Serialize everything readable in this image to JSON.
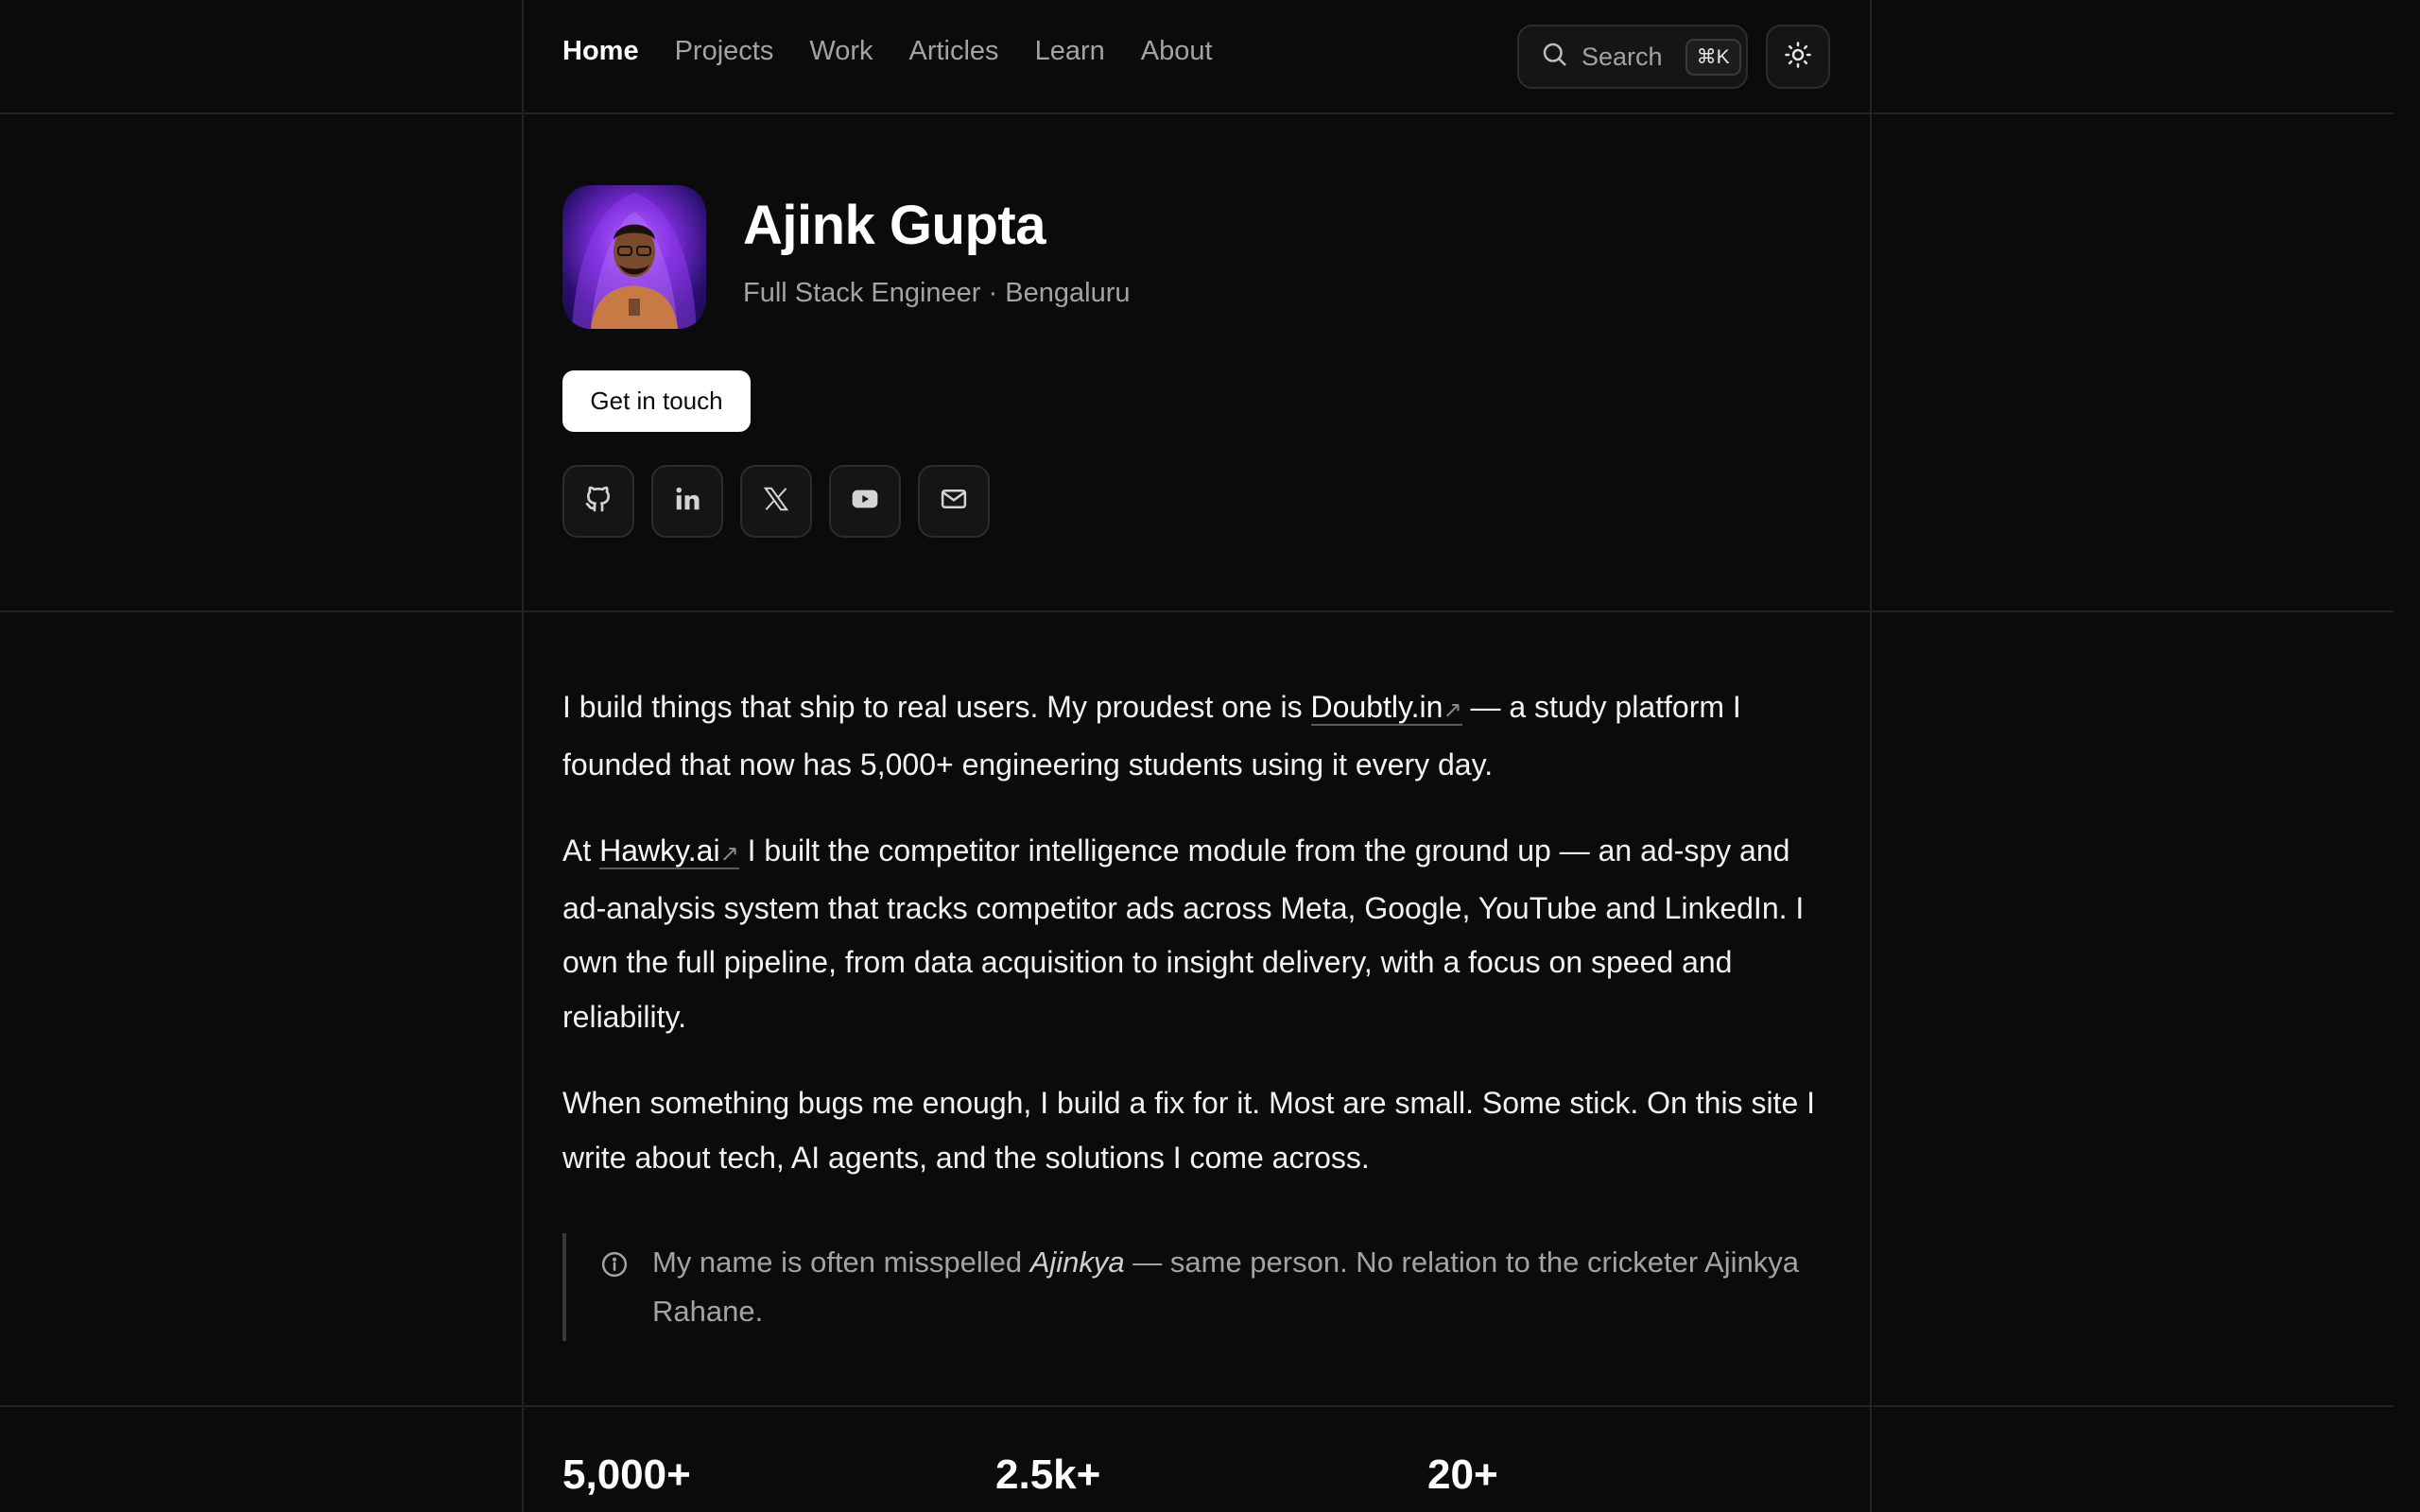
{
  "nav": {
    "items": [
      {
        "label": "Home",
        "active": true
      },
      {
        "label": "Projects"
      },
      {
        "label": "Work"
      },
      {
        "label": "Articles"
      },
      {
        "label": "Learn"
      },
      {
        "label": "About"
      }
    ],
    "search": {
      "label": "Search",
      "shortcut": "⌘K",
      "icon": "search-icon"
    },
    "theme_toggle_icon": "sun-icon"
  },
  "profile": {
    "name": "Ajink Gupta",
    "role": "Full Stack Engineer",
    "separator": "·",
    "location": "Bengaluru",
    "cta_label": "Get in touch",
    "socials": [
      "github-icon",
      "linkedin-icon",
      "x-icon",
      "youtube-icon",
      "mail-icon"
    ]
  },
  "bio": {
    "p1": {
      "before": "I build things that ship to real users. My proudest one is ",
      "link": "Doubtly.in",
      "after": " — a study platform I founded that now has 5,000+ engineering students using it every day."
    },
    "p2": {
      "before": "At ",
      "link": "Hawky.ai",
      "after": " I built the competitor intelligence module from the ground up — an ad-spy and ad-analysis system that tracks competitor ads across Meta, Google, YouTube and LinkedIn. I own the full pipeline, from data acquisition to insight delivery, with a focus on speed and reliability."
    },
    "p3": "When something bugs me enough, I build a fix for it. Most are small. Some stick. On this site I write about tech, AI agents, and the solutions I come across.",
    "ext_arrow": "↗"
  },
  "note": {
    "before": "My name is often misspelled ",
    "emphasis": "Ajinkya",
    "after": " — same person. No relation to the cricketer Ajinkya Rahane."
  },
  "stats": [
    {
      "value": "5,000+"
    },
    {
      "value": "2.5k+"
    },
    {
      "value": "20+"
    }
  ],
  "colors": {
    "background": "#0b0b0b",
    "text": "#f2f2f2",
    "muted": "#a3a3a3",
    "border": "#232323",
    "button_bg": "#ffffff"
  }
}
